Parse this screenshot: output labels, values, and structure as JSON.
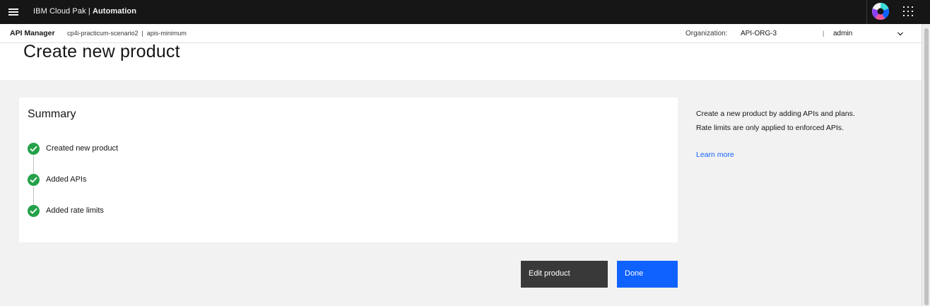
{
  "topbar": {
    "brand_prefix": "IBM Cloud Pak | ",
    "brand_bold": "Automation",
    "menu_icon": "hamburger-menu-icon",
    "logo_icon": "cloud-pak-logo-icon",
    "apps_icon": "app-switcher-grid-icon"
  },
  "subbar": {
    "app_name": "API Manager",
    "breadcrumbs": [
      "cp4i-practicum-scenario2",
      "apis-minimum"
    ],
    "breadcrumb_separator": "|",
    "org_label": "Organization:",
    "org_value": "API-ORG-3",
    "separator": "|",
    "user": "admin",
    "user_menu_icon": "chevron-down-icon"
  },
  "page": {
    "title": "Create new product"
  },
  "summary": {
    "title": "Summary",
    "steps": [
      {
        "label": "Created new product",
        "status": "complete"
      },
      {
        "label": "Added APIs",
        "status": "complete"
      },
      {
        "label": "Added rate limits",
        "status": "complete"
      }
    ],
    "status_icon": "checkmark-filled-icon"
  },
  "help": {
    "line1": "Create a new product by adding APIs and plans.",
    "line2": "Rate limits are only applied to enforced APIs.",
    "learn_more": "Learn more"
  },
  "actions": {
    "edit_label": "Edit product",
    "done_label": "Done"
  },
  "colors": {
    "topbar_bg": "#161616",
    "primary": "#0f62fe",
    "secondary_button": "#393939",
    "success": "#24a148",
    "page_bg": "#f2f2f2"
  }
}
